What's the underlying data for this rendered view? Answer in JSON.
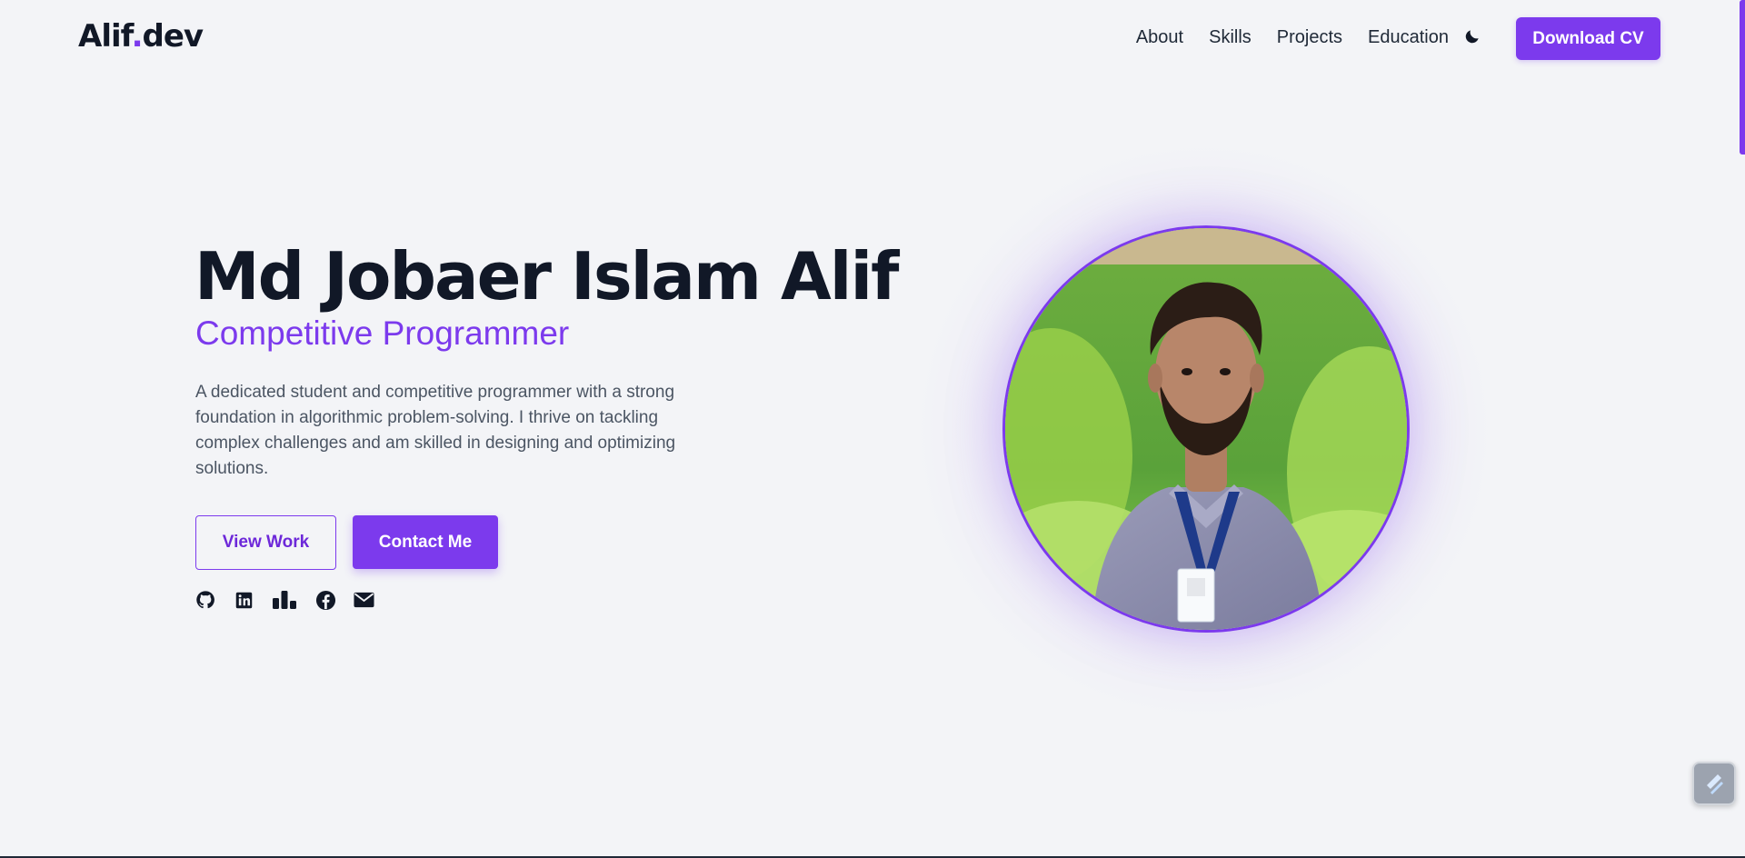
{
  "header": {
    "logo_text": "Alif",
    "logo_dot": ".",
    "logo_suffix": "dev",
    "nav": [
      "About",
      "Skills",
      "Projects",
      "Education"
    ],
    "theme_icon": "moon-icon",
    "cv_button": "Download CV"
  },
  "hero": {
    "name": "Md Jobaer Islam Alif",
    "role": "Competitive Programmer",
    "description": "A dedicated student and competitive programmer with a strong foundation in algorithmic problem-solving. I thrive on tackling complex challenges and am skilled in designing and optimizing solutions.",
    "primary_button": "View Work",
    "secondary_button": "Contact Me",
    "socials": [
      "github-icon",
      "linkedin-icon",
      "stats-icon",
      "facebook-icon",
      "mail-icon"
    ]
  },
  "colors": {
    "accent": "#7c3aed",
    "background": "#f3f4f7",
    "text": "#111827"
  }
}
